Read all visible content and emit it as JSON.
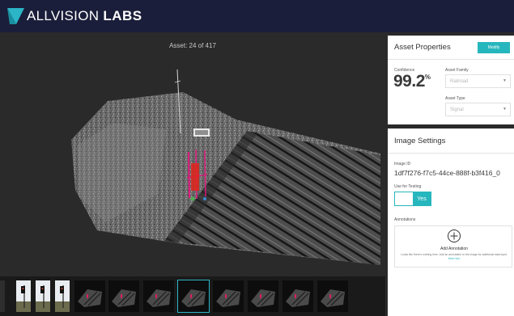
{
  "header": {
    "brand_light": "ALLVISION",
    "brand_bold": "LABS",
    "logo_color": "#2bb5c7"
  },
  "viewer": {
    "asset_counter": "Asset:  24 of 417",
    "thumbnails": [
      {
        "kind": "photo"
      },
      {
        "kind": "photo"
      },
      {
        "kind": "photo"
      },
      {
        "kind": "pointcloud"
      },
      {
        "kind": "pointcloud"
      },
      {
        "kind": "pointcloud"
      },
      {
        "kind": "pointcloud",
        "selected": true
      },
      {
        "kind": "pointcloud"
      },
      {
        "kind": "pointcloud"
      },
      {
        "kind": "pointcloud"
      },
      {
        "kind": "pointcloud"
      }
    ]
  },
  "asset_properties": {
    "title": "Asset Properties",
    "modify_label": "Modify",
    "confidence_label": "Confidence",
    "confidence_value": "99.2",
    "confidence_unit": "%",
    "family_label": "Asset Family",
    "family_value": "Railroad",
    "type_label": "Asset Type",
    "type_value": "Signal"
  },
  "image_settings": {
    "title": "Image Settings",
    "image_id_label": "Image ID",
    "image_id_value": "1df7f276-f7c5-44ce-888f-b3f416_0",
    "testing_label": "Use for Testing",
    "testing_value": "Yes",
    "annotations_label": "Annotations",
    "add_annotation": "Add Annotation",
    "annotation_hint": "Looks like there's nothing here.  Add an annotation to the image for additional data input.",
    "more_info": "More Info"
  },
  "colors": {
    "accent": "#26b6bd",
    "topbar": "#1b1e3a",
    "annotation_marker": "#e0197d",
    "annotation_mark": "#e0241b"
  }
}
